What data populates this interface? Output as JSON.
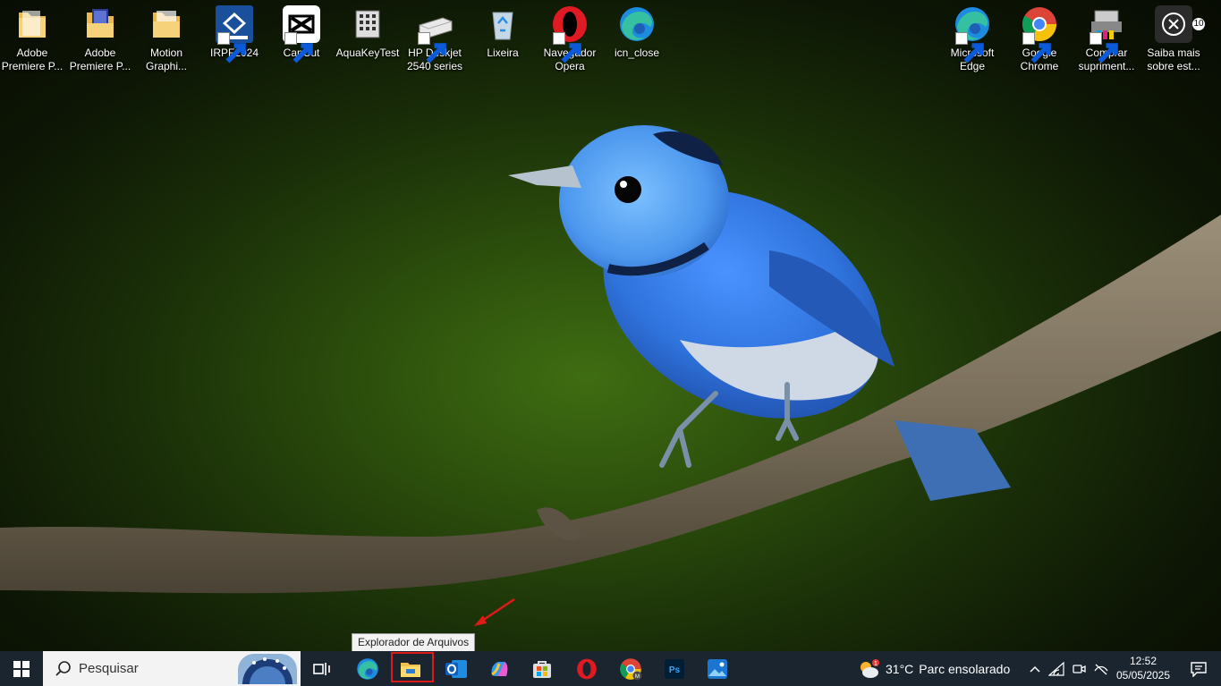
{
  "desktop": {
    "icons_left": [
      {
        "label": "Adobe Premiere P...",
        "icon": "folder-icon"
      },
      {
        "label": "Adobe Premiere P...",
        "icon": "premiere-folder-icon"
      },
      {
        "label": "Motion Graphi...",
        "icon": "folder-icon"
      },
      {
        "label": "IRPF2024",
        "icon": "irpf-icon"
      },
      {
        "label": "CapCut",
        "icon": "capcut-icon"
      },
      {
        "label": "AquaKeyTest",
        "icon": "keypad-icon"
      },
      {
        "label": "HP Deskjet 2540 series",
        "icon": "printer-icon"
      },
      {
        "label": "Lixeira",
        "icon": "recycle-bin-icon"
      },
      {
        "label": "Navegador Opera",
        "icon": "opera-icon"
      },
      {
        "label": "icn_close",
        "icon": "edge-icon"
      }
    ],
    "icons_right": [
      {
        "label": "Microsoft Edge",
        "icon": "edge-icon"
      },
      {
        "label": "Google Chrome",
        "icon": "chrome-icon"
      },
      {
        "label": "Comprar supriment...",
        "icon": "printer-ink-icon"
      },
      {
        "label": "Saiba mais sobre est...",
        "icon": "spotlight-icon"
      }
    ]
  },
  "tooltip": {
    "text": "Explorador de Arquivos"
  },
  "taskbar": {
    "search_placeholder": "Pesquisar",
    "pinned": [
      "task-view-icon",
      "edge-icon",
      "file-explorer-icon",
      "outlook-icon",
      "copilot-icon",
      "store-icon",
      "opera-icon",
      "chrome-icon",
      "photoshop-icon",
      "photos-icon"
    ],
    "photoshop_label": "Ps",
    "chrome_badge": "M",
    "weather": {
      "temp": "31°C",
      "condition": "Parc ensolarado",
      "badge": "1"
    },
    "clock": {
      "time": "12:52",
      "date": "05/05/2025"
    },
    "notifications_count": "10"
  },
  "colors": {
    "taskbar": "#1b2530",
    "highlight": "#e01919",
    "bird_blue": "#2f7be0"
  }
}
